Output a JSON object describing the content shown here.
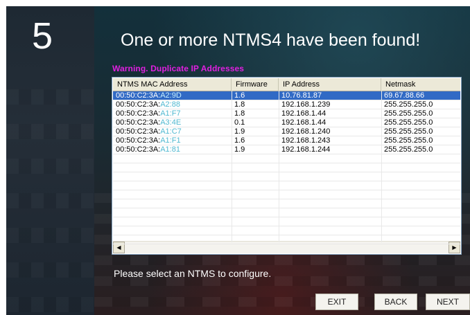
{
  "step": {
    "number": "5"
  },
  "header": {
    "title": "One or more NTMS4 have been found!"
  },
  "warning": {
    "text": "Warning. Duplicate IP Addresses"
  },
  "table": {
    "columns": [
      "NTMS MAC Address",
      "Firmware",
      "IP Address",
      "Netmask"
    ],
    "rows": [
      {
        "mac_prefix": "00:50:C2:3A:",
        "mac_suffix": "A2:9D",
        "firmware": "1.6",
        "ip": "10.76.81.87",
        "netmask": "69.67.88.66",
        "selected": true
      },
      {
        "mac_prefix": "00:50:C2:3A:",
        "mac_suffix": "A2:88",
        "firmware": "1.8",
        "ip": "192.168.1.239",
        "netmask": "255.255.255.0",
        "selected": false
      },
      {
        "mac_prefix": "00:50:C2:3A:",
        "mac_suffix": "A1:F7",
        "firmware": "1.8",
        "ip": "192.168.1.44",
        "netmask": "255.255.255.0",
        "selected": false
      },
      {
        "mac_prefix": "00:50:C2:3A:",
        "mac_suffix": "A3:4E",
        "firmware": "0.1",
        "ip": "192.168.1.44",
        "netmask": "255.255.255.0",
        "selected": false
      },
      {
        "mac_prefix": "00:50:C2:3A:",
        "mac_suffix": "A1:C7",
        "firmware": "1.9",
        "ip": "192.168.1.240",
        "netmask": "255.255.255.0",
        "selected": false
      },
      {
        "mac_prefix": "00:50:C2:3A:",
        "mac_suffix": "A1:F1",
        "firmware": "1.6",
        "ip": "192.168.1.243",
        "netmask": "255.255.255.0",
        "selected": false
      },
      {
        "mac_prefix": "00:50:C2:3A:",
        "mac_suffix": "A1:81",
        "firmware": "1.9",
        "ip": "192.168.1.244",
        "netmask": "255.255.255.0",
        "selected": false
      }
    ]
  },
  "scrollbar": {
    "left_icon": "scroll-left-arrow",
    "right_icon": "scroll-right-arrow"
  },
  "prompt": {
    "text": "Please select an NTMS to configure."
  },
  "buttons": {
    "exit": "EXIT",
    "back": "BACK",
    "next": "NEXT"
  },
  "colors": {
    "selection": "#316ac5",
    "warning": "#e020e0",
    "mac_highlight": "#4fb8d0"
  }
}
